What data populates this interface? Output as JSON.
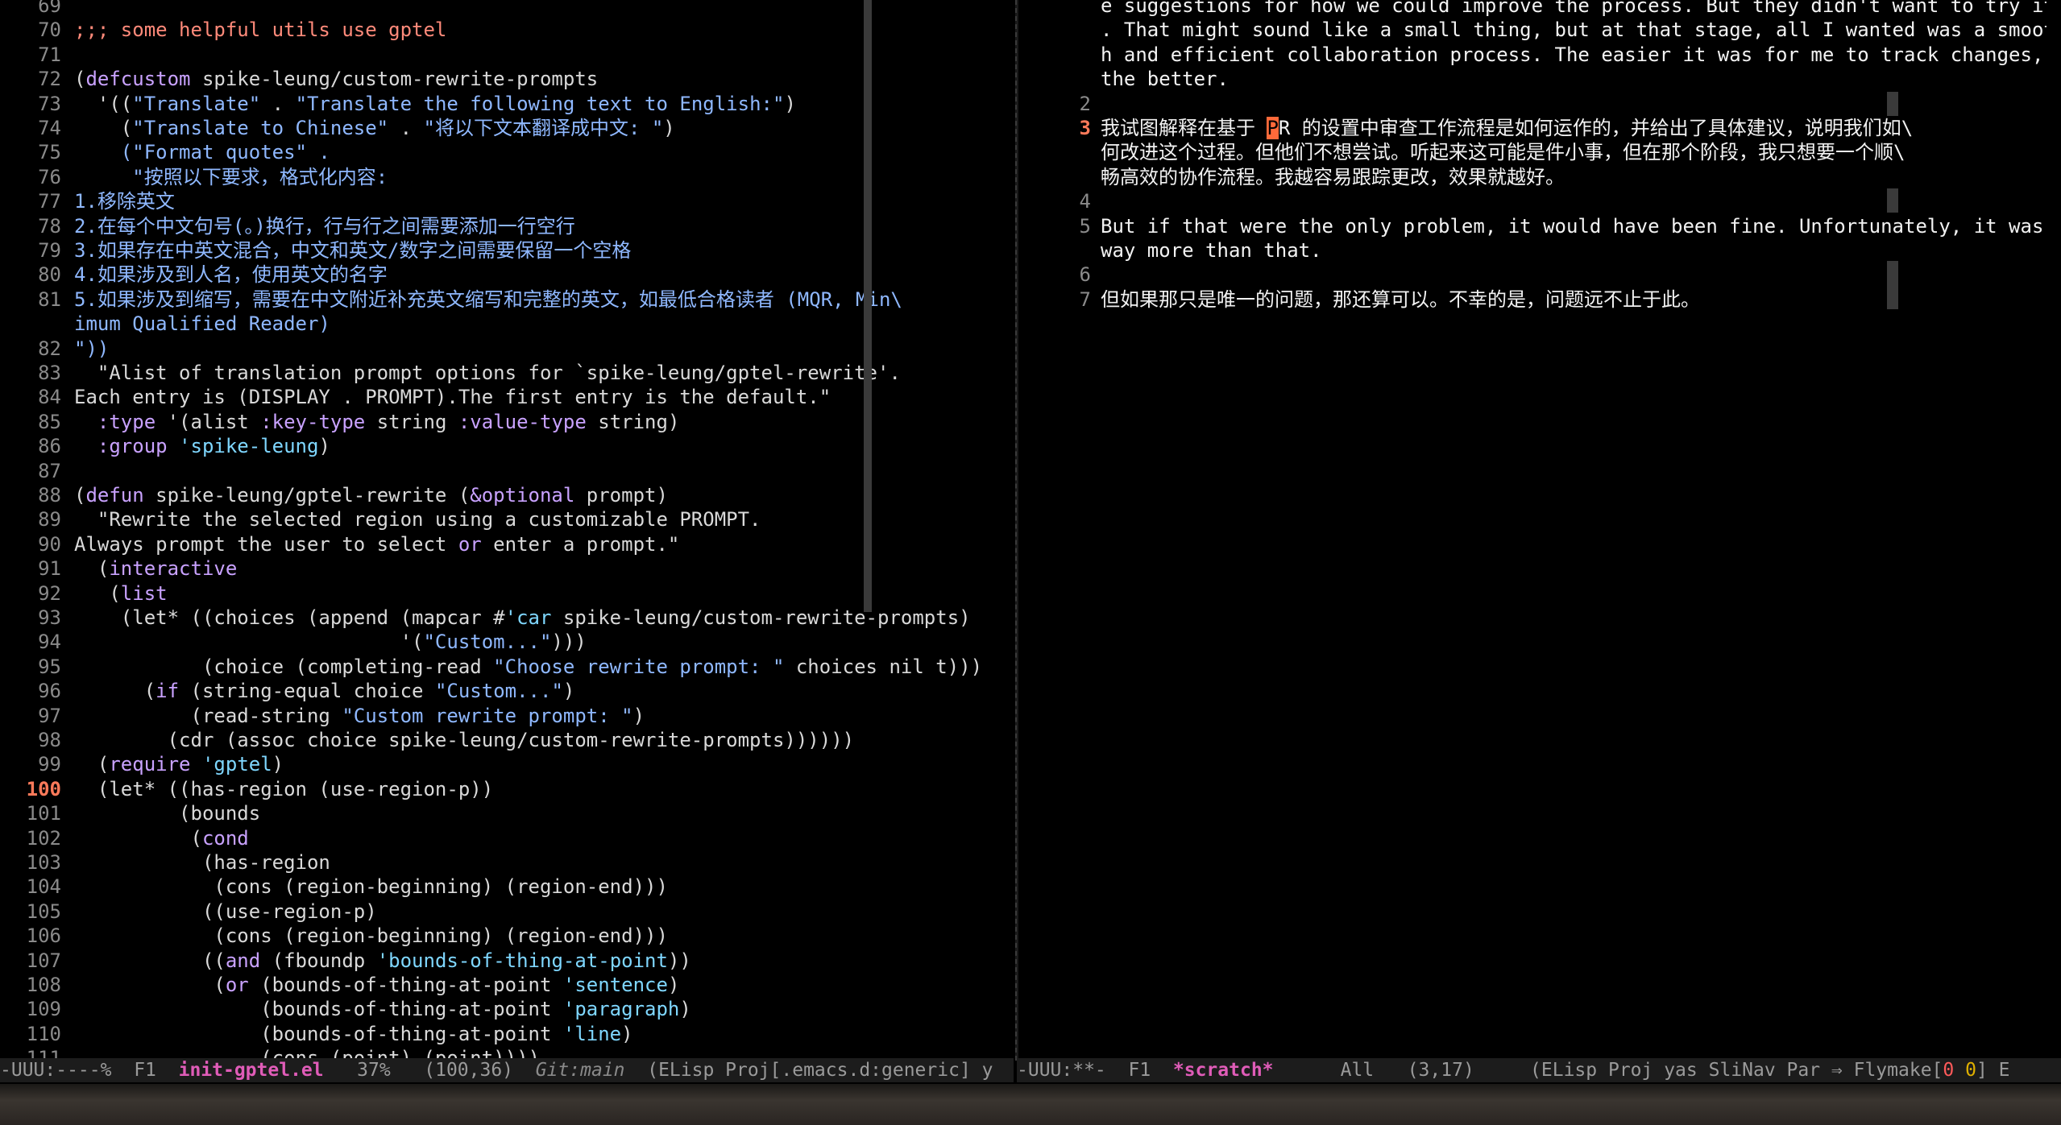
{
  "left": {
    "lines": [
      {
        "n": "69",
        "t": ""
      },
      {
        "n": "70",
        "t": ";;; some helpful utils use gptel",
        "cls": "c-comment"
      },
      {
        "n": "71",
        "t": ""
      },
      {
        "n": "72",
        "t": "(defcustom spike-leung/custom-rewrite-prompts"
      },
      {
        "n": "73",
        "t": "  '((\"Translate\" . \"Translate the following text to English:\")"
      },
      {
        "n": "74",
        "t": "    (\"Translate to Chinese\" . \"将以下文本翻译成中文: \")"
      },
      {
        "n": "75",
        "t": "    (\"Format quotes\" ."
      },
      {
        "n": "76",
        "t": "     \"按照以下要求，格式化内容:"
      },
      {
        "n": "77",
        "t": "1.移除英文"
      },
      {
        "n": "78",
        "t": "2.在每个中文句号(。)换行，行与行之间需要添加一行空行"
      },
      {
        "n": "79",
        "t": "3.如果存在中英文混合，中文和英文/数字之间需要保留一个空格"
      },
      {
        "n": "80",
        "t": "4.如果涉及到人名，使用英文的名字"
      },
      {
        "n": "81",
        "t": "5.如果涉及到缩写，需要在中文附近补充英文缩写和完整的英文，如最低合格读者 (MQR, Min\\"
      },
      {
        "n": "",
        "t": "imum Qualified Reader)"
      },
      {
        "n": "82",
        "t": "\"))"
      },
      {
        "n": "83",
        "t": "  \"Alist of translation prompt options for `spike-leung/gptel-rewrite'."
      },
      {
        "n": "84",
        "t": "Each entry is (DISPLAY . PROMPT).The first entry is the default.\""
      },
      {
        "n": "85",
        "t": "  :type '(alist :key-type string :value-type string)"
      },
      {
        "n": "86",
        "t": "  :group 'spike-leung)"
      },
      {
        "n": "87",
        "t": ""
      },
      {
        "n": "88",
        "t": "(defun spike-leung/gptel-rewrite (&optional prompt)"
      },
      {
        "n": "89",
        "t": "  \"Rewrite the selected region using a customizable PROMPT."
      },
      {
        "n": "90",
        "t": "Always prompt the user to select or enter a prompt.\""
      },
      {
        "n": "91",
        "t": "  (interactive"
      },
      {
        "n": "92",
        "t": "   (list"
      },
      {
        "n": "93",
        "t": "    (let* ((choices (append (mapcar #'car spike-leung/custom-rewrite-prompts)"
      },
      {
        "n": "94",
        "t": "                            '(\"Custom...\")))"
      },
      {
        "n": "95",
        "t": "           (choice (completing-read \"Choose rewrite prompt: \" choices nil t)))"
      },
      {
        "n": "96",
        "t": "      (if (string-equal choice \"Custom...\")"
      },
      {
        "n": "97",
        "t": "          (read-string \"Custom rewrite prompt: \")"
      },
      {
        "n": "98",
        "t": "        (cdr (assoc choice spike-leung/custom-rewrite-prompts))))))"
      },
      {
        "n": "99",
        "t": "  (require 'gptel)"
      },
      {
        "n": "100",
        "t": "  (let* ((has-region (use-region-p))",
        "cur": true
      },
      {
        "n": "101",
        "t": "         (bounds"
      },
      {
        "n": "102",
        "t": "          (cond"
      },
      {
        "n": "103",
        "t": "           (has-region"
      },
      {
        "n": "104",
        "t": "            (cons (region-beginning) (region-end)))"
      },
      {
        "n": "105",
        "t": "           ((use-region-p)"
      },
      {
        "n": "106",
        "t": "            (cons (region-beginning) (region-end)))"
      },
      {
        "n": "107",
        "t": "           ((and (fboundp 'bounds-of-thing-at-point))"
      },
      {
        "n": "108",
        "t": "            (or (bounds-of-thing-at-point 'sentence)"
      },
      {
        "n": "109",
        "t": "                (bounds-of-thing-at-point 'paragraph)"
      },
      {
        "n": "110",
        "t": "                (bounds-of-thing-at-point 'line)"
      },
      {
        "n": "111",
        "t": "                (cons (point) (point))))"
      }
    ]
  },
  "right": {
    "lines": [
      {
        "n": "",
        "t": "e suggestions for how we could improve the process. But they didn't want to try it\\"
      },
      {
        "n": "",
        "t": ". That might sound like a small thing, but at that stage, all I wanted was a smoot\\"
      },
      {
        "n": "",
        "t": "h and efficient collaboration process. The easier it was for me to track changes, \\"
      },
      {
        "n": "",
        "t": "the better."
      },
      {
        "n": "2",
        "t": ""
      },
      {
        "n": "3",
        "t": "我试图解释在基于 PR 的设置中审查工作流程是如何运作的，并给出了具体建议，说明我们如\\",
        "cur": true
      },
      {
        "n": "",
        "t": "何改进这个过程。但他们不想尝试。听起来这可能是件小事，但在那个阶段，我只想要一个顺\\"
      },
      {
        "n": "",
        "t": "畅高效的协作流程。我越容易跟踪更改，效果就越好。"
      },
      {
        "n": "4",
        "t": ""
      },
      {
        "n": "5",
        "t": "But if that were the only problem, it would have been fine. Unfortunately, it was \\"
      },
      {
        "n": "",
        "t": "way more than that."
      },
      {
        "n": "6",
        "t": ""
      },
      {
        "n": "7",
        "t": "但如果那只是唯一的问题，那还算可以。不幸的是，问题远不止于此。"
      }
    ]
  },
  "modeline_left": {
    "state": "-UUU:----%",
    "frame": "F1",
    "buffer": "init-gptel.el",
    "percent": "37%",
    "pos": "(100,36)",
    "git": "Git:main",
    "modes": "(ELisp Proj[.emacs.d:generic] y"
  },
  "modeline_right": {
    "state": "-UUU:**-",
    "frame": "F1",
    "buffer": "*scratch*",
    "percent": "All",
    "pos": "(3,17)",
    "modes": "(ELisp Proj yas SliNav Par ⇒ Flymake[",
    "fly_err": "0",
    "fly_warn": "0",
    "tail": "] E"
  }
}
